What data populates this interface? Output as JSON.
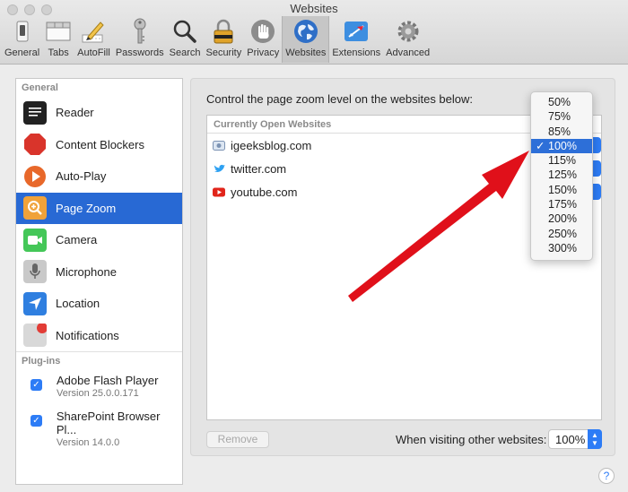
{
  "window": {
    "title": "Websites"
  },
  "toolbar": {
    "items": [
      {
        "label": "General",
        "icon": "general-switch-icon"
      },
      {
        "label": "Tabs",
        "icon": "tabs-icon"
      },
      {
        "label": "AutoFill",
        "icon": "autofill-pencil-icon"
      },
      {
        "label": "Passwords",
        "icon": "key-icon"
      },
      {
        "label": "Search",
        "icon": "magnifier-icon"
      },
      {
        "label": "Security",
        "icon": "padlock-icon"
      },
      {
        "label": "Privacy",
        "icon": "hand-icon"
      },
      {
        "label": "Websites",
        "icon": "globe-icon",
        "active": true
      },
      {
        "label": "Extensions",
        "icon": "puzzle-arrow-icon"
      },
      {
        "label": "Advanced",
        "icon": "gear-icon"
      }
    ]
  },
  "sidebar": {
    "general_header": "General",
    "items": [
      {
        "label": "Reader",
        "icon": "reader-icon"
      },
      {
        "label": "Content Blockers",
        "icon": "stop-octagon-icon"
      },
      {
        "label": "Auto-Play",
        "icon": "play-icon"
      },
      {
        "label": "Page Zoom",
        "icon": "zoom-icon",
        "selected": true
      },
      {
        "label": "Camera",
        "icon": "camera-icon"
      },
      {
        "label": "Microphone",
        "icon": "microphone-icon"
      },
      {
        "label": "Location",
        "icon": "location-arrow-icon"
      },
      {
        "label": "Notifications",
        "icon": "notification-badge-icon"
      }
    ],
    "plugins_header": "Plug-ins",
    "plugins": [
      {
        "name": "Adobe Flash Player",
        "version": "Version 25.0.0.171",
        "checked": true
      },
      {
        "name": "SharePoint Browser Pl...",
        "version": "Version 14.0.0",
        "checked": true
      }
    ]
  },
  "main": {
    "instruction": "Control the page zoom level on the websites below:",
    "table_header": "Currently Open Websites",
    "sites": [
      {
        "name": "igeeksblog.com",
        "icon": "igeeks-favicon-icon"
      },
      {
        "name": "twitter.com",
        "icon": "twitter-bird-icon"
      },
      {
        "name": "youtube.com",
        "icon": "youtube-play-icon"
      }
    ],
    "remove_label": "Remove",
    "other_label": "When visiting other websites:",
    "other_value": "100%"
  },
  "zoom_menu": {
    "options": [
      "50%",
      "75%",
      "85%",
      "100%",
      "115%",
      "125%",
      "150%",
      "175%",
      "200%",
      "250%",
      "300%"
    ],
    "selected": "100%",
    "checkmark": "✓"
  },
  "help": {
    "label": "?"
  },
  "colors": {
    "accent": "#2869d4",
    "annotation_arrow": "#e0101a"
  }
}
